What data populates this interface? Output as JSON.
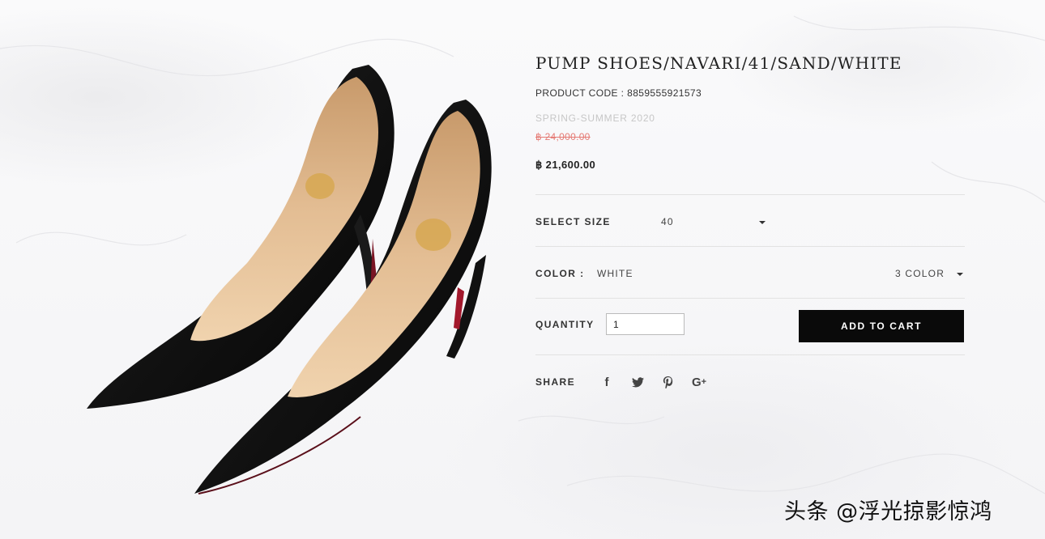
{
  "product": {
    "title": "PUMP SHOES/NAVARI/41/SAND/WHITE",
    "code_label": "PRODUCT CODE :",
    "code_value": "8859555921573",
    "season": "SPRING-SUMMER 2020",
    "original_price": "฿ 24,000.00",
    "sale_price": "฿ 21,600.00",
    "image_alt": "black pointed-toe stiletto pumps"
  },
  "size": {
    "label": "SELECT SIZE",
    "selected": "40",
    "icon": "chevron-down-icon"
  },
  "color": {
    "label": "COLOR :",
    "selected": "WHITE",
    "count_label": "3 COLOR",
    "icon": "chevron-down-icon"
  },
  "quantity": {
    "label": "QUANTITY",
    "value": "1"
  },
  "cart": {
    "button_label": "ADD TO CART"
  },
  "share": {
    "label": "SHARE",
    "icons": [
      {
        "name": "facebook-icon",
        "glyph": "f"
      },
      {
        "name": "twitter-icon",
        "glyph": "🐦"
      },
      {
        "name": "pinterest-icon",
        "glyph": "P"
      },
      {
        "name": "google-plus-icon",
        "glyph": "G+"
      }
    ]
  },
  "watermark": "头条 @浮光掠影惊鸿",
  "colors": {
    "accent_button": "#0a0a0a",
    "strike_price": "#e57a74",
    "divider": "#e2e2e2"
  }
}
